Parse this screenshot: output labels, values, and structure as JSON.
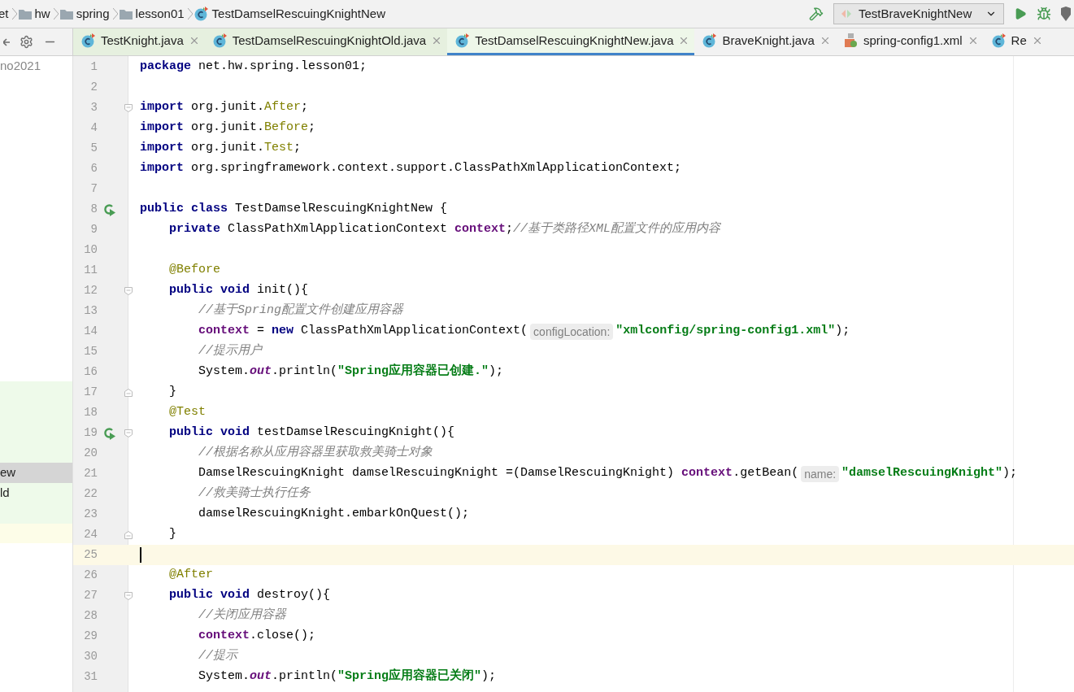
{
  "breadcrumbs": [
    {
      "kind": "text",
      "label": "et"
    },
    {
      "kind": "folder",
      "label": "hw"
    },
    {
      "kind": "folder",
      "label": "spring"
    },
    {
      "kind": "folder",
      "label": "lesson01"
    },
    {
      "kind": "class",
      "label": "TestDamselRescuingKnightNew"
    }
  ],
  "run_config": {
    "label": "TestBraveKnightNew"
  },
  "tabs": [
    {
      "label": "TestKnight.java",
      "kind": "class",
      "color": "#e6f0df",
      "selected": false
    },
    {
      "label": "TestDamselRescuingKnightOld.java",
      "kind": "class",
      "color": "#e6f0df",
      "selected": false
    },
    {
      "label": "TestDamselRescuingKnightNew.java",
      "kind": "class",
      "color": "#eef7e9",
      "selected": true
    },
    {
      "label": "BraveKnight.java",
      "kind": "class",
      "color": "#f2f2f2",
      "selected": false
    },
    {
      "label": "spring-config1.xml",
      "kind": "xml",
      "color": "#f2f2f2",
      "selected": false
    },
    {
      "label": "Re",
      "kind": "class",
      "color": "#f2f2f2",
      "selected": false
    }
  ],
  "project_panel": {
    "items": [
      {
        "label": "no2021",
        "selected": false
      },
      {
        "label": "ew",
        "selected": true
      },
      {
        "label": "ld",
        "selected": false
      }
    ]
  },
  "editor": {
    "lines": [
      {
        "number": "1",
        "tokens": [
          {
            "kind": "kw",
            "text": "package"
          },
          {
            "kind": "plain",
            "text": " net.hw.spring.lesson01;"
          }
        ]
      },
      {
        "number": "2"
      },
      {
        "number": "3",
        "fold_start": true,
        "tokens": [
          {
            "kind": "kw",
            "text": "import"
          },
          {
            "kind": "plain",
            "text": " org.junit."
          },
          {
            "kind": "ann",
            "text": "After"
          },
          {
            "kind": "plain",
            "text": ";"
          }
        ]
      },
      {
        "number": "4",
        "tokens": [
          {
            "kind": "kw",
            "text": "import"
          },
          {
            "kind": "plain",
            "text": " org.junit."
          },
          {
            "kind": "ann",
            "text": "Before"
          },
          {
            "kind": "plain",
            "text": ";"
          }
        ]
      },
      {
        "number": "5",
        "tokens": [
          {
            "kind": "kw",
            "text": "import"
          },
          {
            "kind": "plain",
            "text": " org.junit."
          },
          {
            "kind": "ann",
            "text": "Test"
          },
          {
            "kind": "plain",
            "text": ";"
          }
        ]
      },
      {
        "number": "6",
        "tokens": [
          {
            "kind": "kw",
            "text": "import"
          },
          {
            "kind": "plain",
            "text": " org.springframework.context.support.ClassPathXmlApplicationContext;"
          }
        ]
      },
      {
        "number": "7"
      },
      {
        "number": "8",
        "run_icon": true,
        "tokens": [
          {
            "kind": "kw",
            "text": "public class"
          },
          {
            "kind": "plain",
            "text": " TestDamselRescuingKnightNew {"
          }
        ]
      },
      {
        "number": "9",
        "tokens": [
          {
            "kind": "kw",
            "text": "    private"
          },
          {
            "kind": "plain",
            "text": " ClassPathXmlApplicationContext "
          },
          {
            "kind": "field",
            "text": "context"
          },
          {
            "kind": "plain",
            "text": ";"
          },
          {
            "kind": "comment",
            "text": "//基于类路径XML配置文件的应用内容"
          }
        ]
      },
      {
        "number": "10"
      },
      {
        "number": "11",
        "tokens": [
          {
            "kind": "ann",
            "text": "    @Before"
          }
        ]
      },
      {
        "number": "12",
        "fold_start": true,
        "tokens": [
          {
            "kind": "kw",
            "text": "    public void"
          },
          {
            "kind": "plain",
            "text": " init(){"
          }
        ]
      },
      {
        "number": "13",
        "tokens": [
          {
            "kind": "comment",
            "text": "        //基于Spring配置文件创建应用容器"
          }
        ]
      },
      {
        "number": "14",
        "tokens": [
          {
            "kind": "field",
            "text": "        context"
          },
          {
            "kind": "plain",
            "text": " = "
          },
          {
            "kind": "kw",
            "text": "new"
          },
          {
            "kind": "plain",
            "text": " ClassPathXmlApplicationContext("
          },
          {
            "kind": "hint",
            "text": "configLocation:"
          },
          {
            "kind": "str",
            "text": "\"xmlconfig/spring-config1.xml\""
          },
          {
            "kind": "plain",
            "text": ");"
          }
        ]
      },
      {
        "number": "15",
        "tokens": [
          {
            "kind": "comment",
            "text": "        //提示用户"
          }
        ]
      },
      {
        "number": "16",
        "tokens": [
          {
            "kind": "plain",
            "text": "        System."
          },
          {
            "kind": "static",
            "text": "out"
          },
          {
            "kind": "plain",
            "text": ".println("
          },
          {
            "kind": "str",
            "text": "\"Spring应用容器已创建.\""
          },
          {
            "kind": "plain",
            "text": ");"
          }
        ]
      },
      {
        "number": "17",
        "fold_end": true,
        "tokens": [
          {
            "kind": "plain",
            "text": "    }"
          }
        ]
      },
      {
        "number": "18",
        "tokens": [
          {
            "kind": "ann",
            "text": "    @Test"
          }
        ]
      },
      {
        "number": "19",
        "run_icon": true,
        "fold_start": true,
        "tokens": [
          {
            "kind": "kw",
            "text": "    public void"
          },
          {
            "kind": "plain",
            "text": " testDamselRescuingKnight(){"
          }
        ]
      },
      {
        "number": "20",
        "tokens": [
          {
            "kind": "comment",
            "text": "        //根据名称从应用容器里获取救美骑士对象"
          }
        ]
      },
      {
        "number": "21",
        "tokens": [
          {
            "kind": "plain",
            "text": "        DamselRescuingKnight damselRescuingKnight =(DamselRescuingKnight) "
          },
          {
            "kind": "field",
            "text": "context"
          },
          {
            "kind": "plain",
            "text": ".getBean("
          },
          {
            "kind": "hint",
            "text": "name:"
          },
          {
            "kind": "str",
            "text": "\"damselRescuingKnight\""
          },
          {
            "kind": "plain",
            "text": ");"
          }
        ]
      },
      {
        "number": "22",
        "tokens": [
          {
            "kind": "comment",
            "text": "        //救美骑士执行任务"
          }
        ]
      },
      {
        "number": "23",
        "tokens": [
          {
            "kind": "plain",
            "text": "        damselRescuingKnight.embarkOnQuest();"
          }
        ]
      },
      {
        "number": "24",
        "fold_end": true,
        "tokens": [
          {
            "kind": "plain",
            "text": "    }"
          }
        ]
      },
      {
        "number": "25",
        "current": true
      },
      {
        "number": "26",
        "tokens": [
          {
            "kind": "ann",
            "text": "    @After"
          }
        ]
      },
      {
        "number": "27",
        "fold_start": true,
        "tokens": [
          {
            "kind": "kw",
            "text": "    public void"
          },
          {
            "kind": "plain",
            "text": " destroy(){"
          }
        ]
      },
      {
        "number": "28",
        "tokens": [
          {
            "kind": "comment",
            "text": "        //关闭应用容器"
          }
        ]
      },
      {
        "number": "29",
        "tokens": [
          {
            "kind": "field",
            "text": "        context"
          },
          {
            "kind": "plain",
            "text": ".close();"
          }
        ]
      },
      {
        "number": "30",
        "tokens": [
          {
            "kind": "comment",
            "text": "        //提示"
          }
        ]
      },
      {
        "number": "31",
        "tokens": [
          {
            "kind": "plain",
            "text": "        System."
          },
          {
            "kind": "static",
            "text": "out"
          },
          {
            "kind": "plain",
            "text": ".println("
          },
          {
            "kind": "str",
            "text": "\"Spring应用容器已关闭\""
          },
          {
            "kind": "plain",
            "text": ");"
          }
        ]
      }
    ]
  }
}
